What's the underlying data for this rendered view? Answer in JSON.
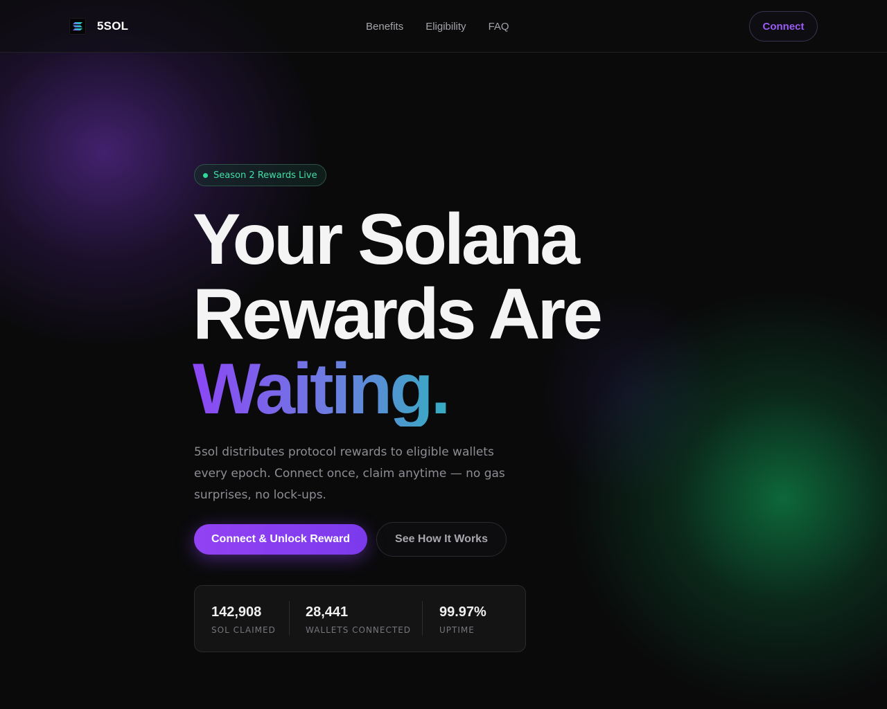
{
  "brand": {
    "name": "5SOL",
    "logo_icon": "solana-logo-icon",
    "colors": {
      "purple": "#9945ff",
      "teal": "#3ea8d8",
      "green": "#14f195"
    }
  },
  "nav": {
    "links": [
      "Benefits",
      "Eligibility",
      "FAQ"
    ],
    "connect_label": "Connect"
  },
  "hero": {
    "badge": "Season 2 Rewards Live",
    "headline_line1": "Your Solana",
    "headline_line2": "Rewards Are",
    "headline_accent": "Waiting.",
    "subtext": "5sol distributes protocol rewards to eligible wallets every epoch. Connect once, claim anytime — no gas surprises, no lock-ups.",
    "primary_cta": "Connect & Unlock Reward",
    "secondary_cta": "See How It Works"
  },
  "stats": [
    {
      "value": "142,908",
      "label": "SOL CLAIMED"
    },
    {
      "value": "28,441",
      "label": "WALLETS CONNECTED"
    },
    {
      "value": "99.97%",
      "label": "UPTIME"
    }
  ],
  "theme": {
    "background": "#0a0a0b",
    "accent_purple": "#9242f3",
    "accent_green": "#2fd99a"
  }
}
